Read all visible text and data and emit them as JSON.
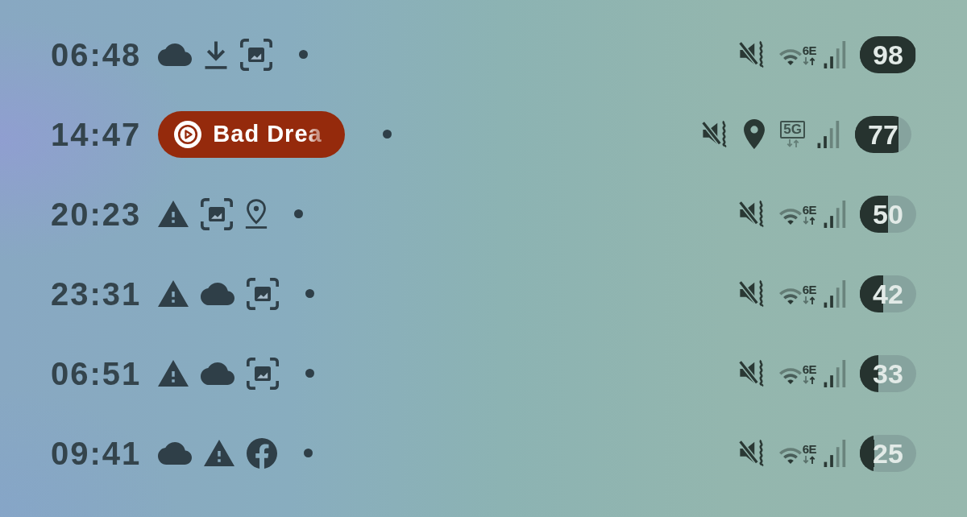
{
  "status_bars": [
    {
      "time": "06:48",
      "notification_icons": [
        {
          "kind": "cloud"
        },
        {
          "kind": "download"
        },
        {
          "kind": "screenshot"
        }
      ],
      "status_icons": [
        {
          "kind": "mute-vibrate"
        },
        {
          "kind": "wifi",
          "label": "6E"
        },
        {
          "kind": "signal"
        }
      ],
      "battery": {
        "reading": "98",
        "level": 0.98
      }
    },
    {
      "time": "14:47",
      "media_chip": {
        "label": "Bad Drea"
      },
      "status_icons": [
        {
          "kind": "mute-vibrate"
        },
        {
          "kind": "location"
        },
        {
          "kind": "mobile-data",
          "label": "5G"
        },
        {
          "kind": "signal"
        }
      ],
      "battery": {
        "reading": "77",
        "level": 0.77
      }
    },
    {
      "time": "20:23",
      "notification_icons": [
        {
          "kind": "warning"
        },
        {
          "kind": "screenshot"
        },
        {
          "kind": "location-outline"
        }
      ],
      "status_icons": [
        {
          "kind": "mute-vibrate"
        },
        {
          "kind": "wifi",
          "label": "6E"
        },
        {
          "kind": "signal"
        }
      ],
      "battery": {
        "reading": "50",
        "level": 0.5
      }
    },
    {
      "time": "23:31",
      "notification_icons": [
        {
          "kind": "warning"
        },
        {
          "kind": "cloud"
        },
        {
          "kind": "screenshot"
        }
      ],
      "status_icons": [
        {
          "kind": "mute-vibrate"
        },
        {
          "kind": "wifi",
          "label": "6E"
        },
        {
          "kind": "signal"
        }
      ],
      "battery": {
        "reading": "42",
        "level": 0.42
      }
    },
    {
      "time": "06:51",
      "notification_icons": [
        {
          "kind": "warning"
        },
        {
          "kind": "cloud"
        },
        {
          "kind": "screenshot"
        }
      ],
      "status_icons": [
        {
          "kind": "mute-vibrate"
        },
        {
          "kind": "wifi",
          "label": "6E"
        },
        {
          "kind": "signal"
        }
      ],
      "battery": {
        "reading": "33",
        "level": 0.33
      }
    },
    {
      "time": "09:41",
      "notification_icons": [
        {
          "kind": "cloud"
        },
        {
          "kind": "warning"
        },
        {
          "kind": "f-logo"
        }
      ],
      "status_icons": [
        {
          "kind": "mute-vibrate"
        },
        {
          "kind": "wifi",
          "label": "6E"
        },
        {
          "kind": "signal"
        }
      ],
      "battery": {
        "reading": "25",
        "level": 0.25
      }
    }
  ]
}
